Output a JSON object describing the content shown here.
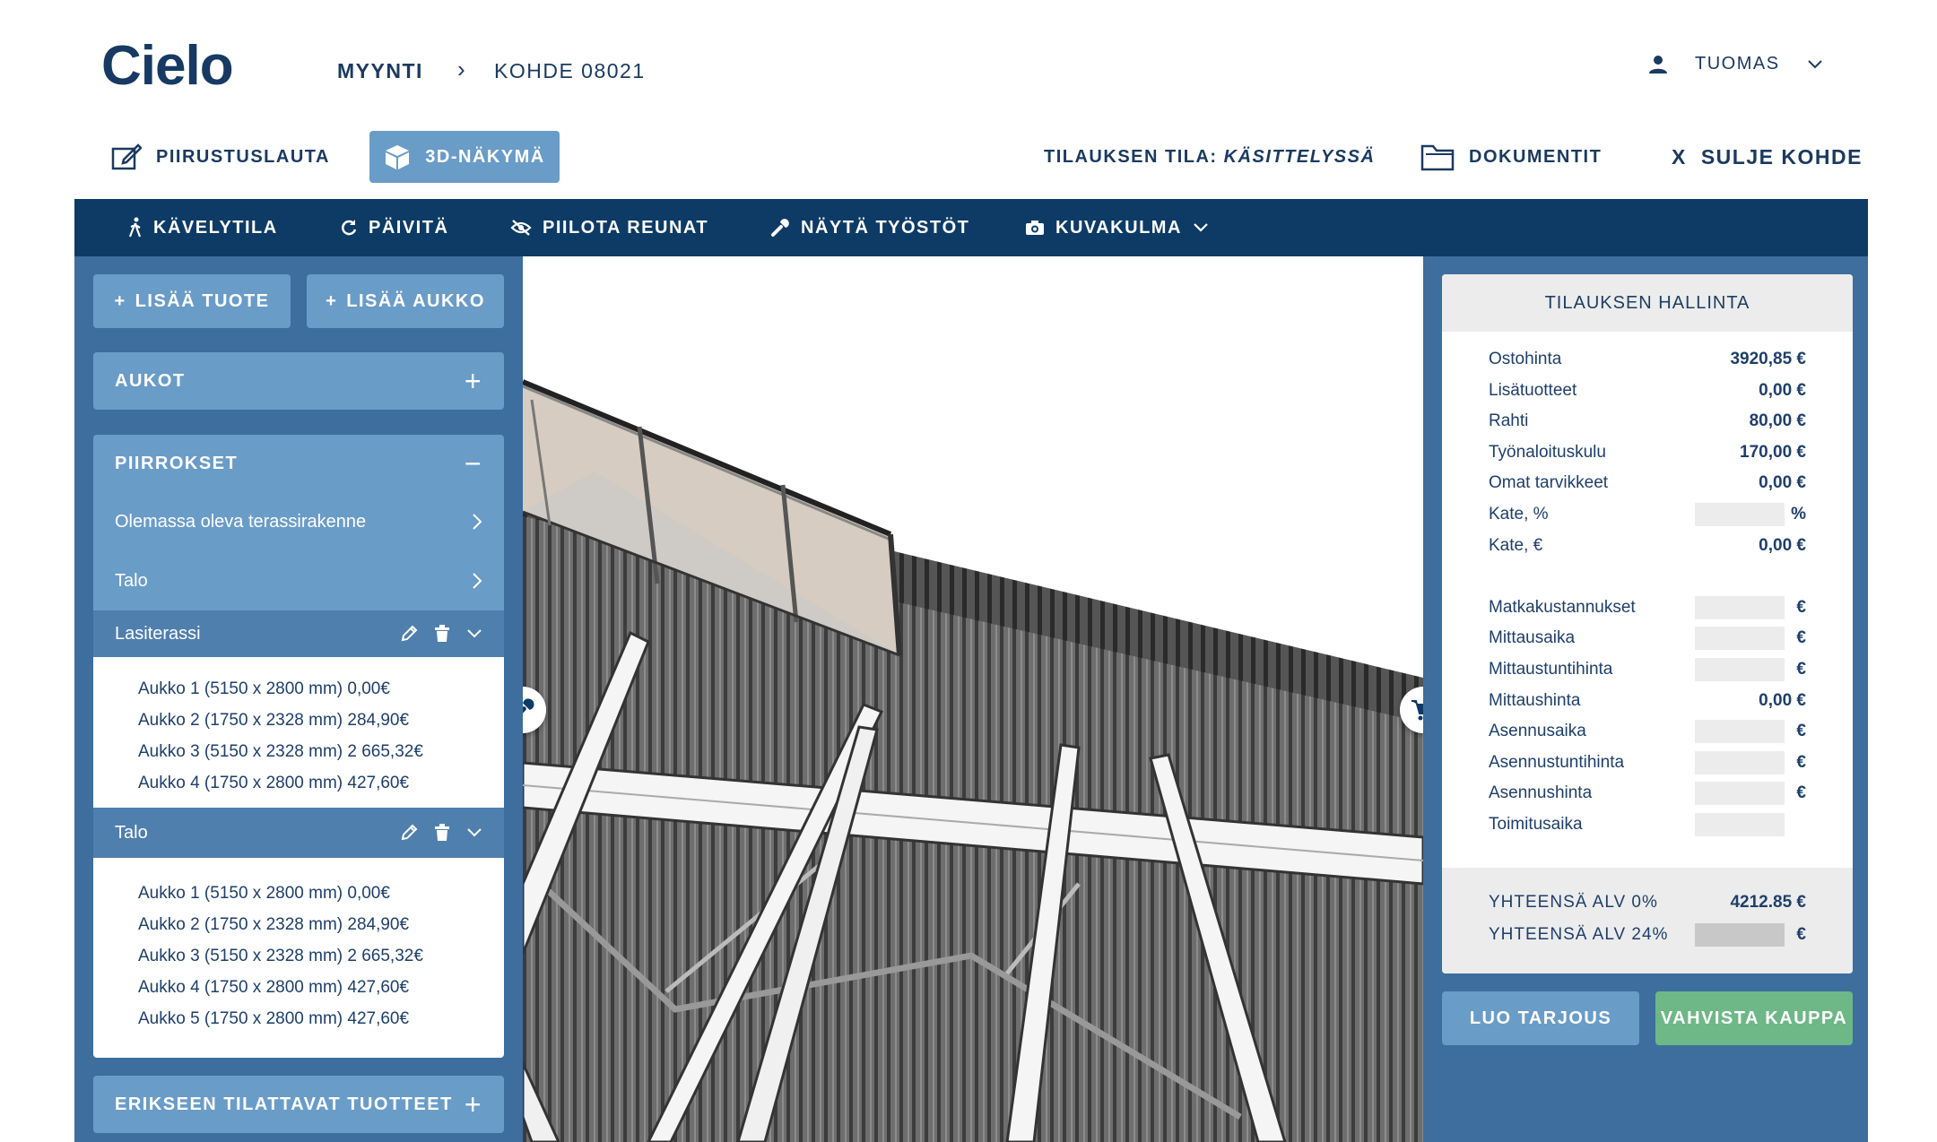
{
  "header": {
    "logo": "Cielo",
    "breadcrumb": [
      "MYYNTI",
      "KOHDE 08021"
    ],
    "breadcrumb_sep": "›",
    "user": "TUOMAS"
  },
  "toolrow": {
    "drawing": "PIIRUSTUSLAUTA",
    "view3d": "3D-NÄKYMÄ",
    "status_label": "TILAUKSEN TILA:",
    "status_value": "KÄSITTELYSSÄ",
    "documents": "DOKUMENTIT",
    "close": "SULJE KOHDE",
    "close_mark": "X"
  },
  "toolbar": {
    "walk": "KÄVELYTILA",
    "refresh": "PÄIVITÄ",
    "hide_edges": "PIILOTA REUNAT",
    "show_work": "NÄYTÄ TYÖSTÖT",
    "camera": "KUVAKULMA"
  },
  "left": {
    "add_product": "LISÄÄ TUOTE",
    "add_opening": "LISÄÄ AUKKO",
    "plus": "+",
    "minus": "−",
    "aukot": "AUKOT",
    "piirrokset": "PIIRROKSET",
    "existing": "Olemassa oleva terassirakenne",
    "talo_link": "Talo",
    "group1": {
      "title": "Lasiterassi",
      "items": [
        "Aukko 1 (5150 x 2800 mm) 0,00€",
        "Aukko 2 (1750 x 2328 mm) 284,90€",
        "Aukko 3 (5150 x 2328 mm) 2 665,32€",
        "Aukko 4 (1750 x 2800 mm) 427,60€"
      ]
    },
    "group2": {
      "title": "Talo",
      "items": [
        "Aukko 1 (5150 x 2800 mm) 0,00€",
        "Aukko 2 (1750 x 2328 mm) 284,90€",
        "Aukko 3 (5150 x 2328 mm) 2 665,32€",
        "Aukko 4 (1750 x 2800 mm) 427,60€",
        "Aukko 5 (1750 x 2800 mm) 427,60€"
      ]
    },
    "separate": "ERIKSEEN TILATTAVAT TUOTTEET"
  },
  "order": {
    "title": "TILAUKSEN HALLINTA",
    "rows": [
      {
        "label": "Ostohinta",
        "value": "3920,85 €",
        "input": false
      },
      {
        "label": "Lisätuotteet",
        "value": "0,00 €",
        "input": false
      },
      {
        "label": "Rahti",
        "value": "80,00 €",
        "input": false
      },
      {
        "label": "Työnaloituskulu",
        "value": "170,00 €",
        "input": false
      },
      {
        "label": "Omat tarvikkeet",
        "value": "0,00 €",
        "input": false
      },
      {
        "label": "Kate, %",
        "value": "%",
        "input": true
      },
      {
        "label": "Kate, €",
        "value": "0,00 €",
        "input": false
      },
      {
        "label": "",
        "value": "",
        "input": false
      },
      {
        "label": "Matkakustannukset",
        "value": "€",
        "input": true
      },
      {
        "label": "Mittausaika",
        "value": "€",
        "input": true
      },
      {
        "label": "Mittaustuntihinta",
        "value": "€",
        "input": true
      },
      {
        "label": "Mittaushinta",
        "value": "0,00 €",
        "input": false
      },
      {
        "label": "Asennusaika",
        "value": "€",
        "input": true
      },
      {
        "label": "Asennustuntihinta",
        "value": "€",
        "input": true
      },
      {
        "label": "Asennushinta",
        "value": "€",
        "input": true
      },
      {
        "label": "Toimitusaika",
        "value": "",
        "input": true
      }
    ],
    "total0_label": "YHTEENSÄ ALV 0%",
    "total0_value": "4212.85 €",
    "total24_label": "YHTEENSÄ ALV 24%",
    "total24_value": "€",
    "create_offer": "LUO TARJOUS",
    "confirm": "VAHVISTA KAUPPA"
  },
  "colors": {
    "navy": "#0d3b66",
    "panel": "#3d6e9d",
    "button": "#6a9cc8",
    "confirm": "#6db886",
    "text": "#1d3e63"
  }
}
